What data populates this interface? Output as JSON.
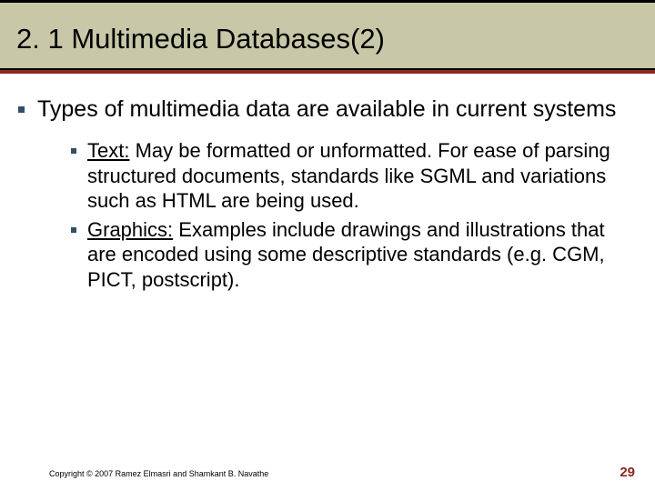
{
  "slide": {
    "title": "2. 1 Multimedia Databases(2)",
    "main": {
      "heading": "Types of multimedia data are available in current systems",
      "items": [
        {
          "label": "Text:",
          "body": " May be formatted or unformatted. For ease of parsing structured documents, standards like SGML and variations such as HTML are being used."
        },
        {
          "label": "Graphics:",
          "body": " Examples include drawings and illustrations that are encoded using some descriptive standards (e.g. CGM, PICT, postscript)."
        }
      ]
    },
    "footer": {
      "copyright": "Copyright © 2007 Ramez Elmasri and Shamkant B. Navathe",
      "page": "29"
    }
  }
}
